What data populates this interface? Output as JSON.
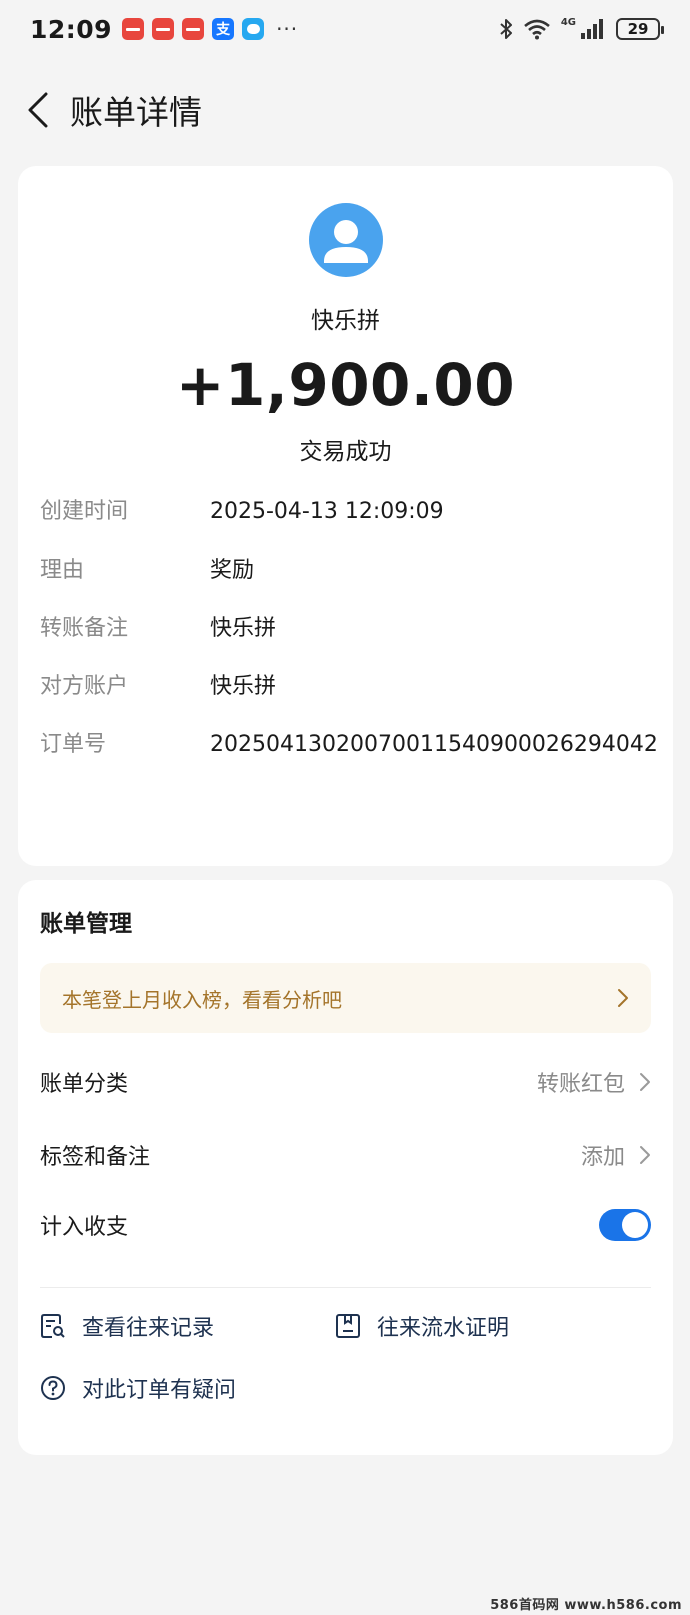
{
  "status_bar": {
    "time": "12:09",
    "network": "4G",
    "battery": "29"
  },
  "header": {
    "title": "账单详情"
  },
  "transaction": {
    "counterparty": "快乐拼",
    "amount": "+1,900.00",
    "status": "交易成功",
    "details": [
      {
        "label": "创建时间",
        "value": "2025-04-13 12:09:09"
      },
      {
        "label": "理由",
        "value": "奖励"
      },
      {
        "label": "转账备注",
        "value": "快乐拼"
      },
      {
        "label": "对方账户",
        "value": "快乐拼"
      },
      {
        "label": "订单号",
        "value": "20250413020070011540900026294042"
      }
    ]
  },
  "management": {
    "title": "账单管理",
    "promo": "本笔登上月收入榜，看看分析吧",
    "category_label": "账单分类",
    "category_value": "转账红包",
    "tag_label": "标签和备注",
    "tag_value": "添加",
    "include_label": "计入收支",
    "include_enabled": true,
    "links": {
      "records": "查看往来记录",
      "proof": "往来流水证明",
      "question": "对此订单有疑问"
    }
  },
  "watermark": "586首码网 www.h586.com",
  "colors": {
    "accent": "#1a74e8",
    "avatar": "#4aa3ee",
    "promo_text": "#a4742a",
    "link_text": "#1e3250"
  }
}
